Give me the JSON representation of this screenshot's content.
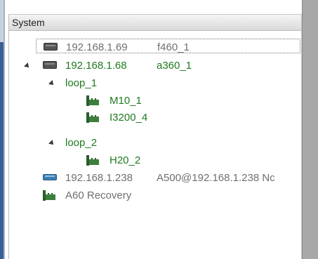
{
  "header": {
    "title": "System"
  },
  "tree": {
    "rows": [
      {
        "ip": "192.168.1.69",
        "name": "f460_1"
      },
      {
        "ip": "192.168.1.68",
        "name": "a360_1"
      },
      {
        "label": "loop_1"
      },
      {
        "label": "M10_1"
      },
      {
        "label": "I3200_4"
      },
      {
        "label": "loop_2"
      },
      {
        "label": "H20_2"
      },
      {
        "ip": "192.168.1.238",
        "name": "A500@192.168.1.238  Nc"
      },
      {
        "label": "A60 Recovery"
      }
    ]
  }
}
